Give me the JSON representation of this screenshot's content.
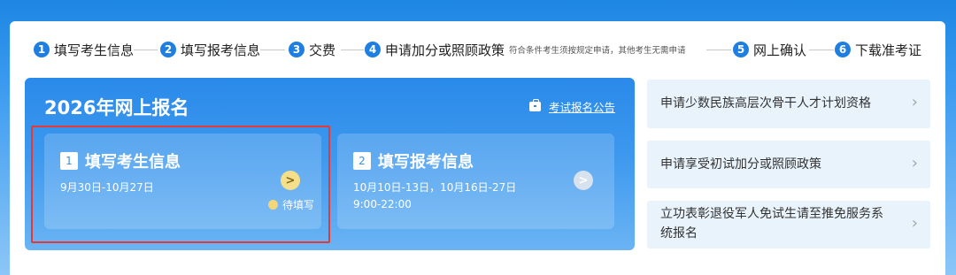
{
  "steps": [
    {
      "num": "1",
      "label": "填写考生信息"
    },
    {
      "num": "2",
      "label": "填写报考信息"
    },
    {
      "num": "3",
      "label": "交费"
    },
    {
      "num": "4",
      "label": "申请加分或照顾政策",
      "note": "符合条件考生须按规定申请，其他考生无需申请"
    },
    {
      "num": "5",
      "label": "网上确认"
    },
    {
      "num": "6",
      "label": "下载准考证"
    }
  ],
  "panel": {
    "title": "2026年网上报名",
    "notice": "考试报名公告",
    "cards": [
      {
        "num": "1",
        "title": "填写考生信息",
        "date": "9月30日-10月27日",
        "status": "待填写"
      },
      {
        "num": "2",
        "title": "填写报考信息",
        "date_line1": "10月10日-13日，10月16日-27日",
        "date_line2": "9:00-22:00"
      }
    ]
  },
  "links": [
    {
      "label": "申请少数民族高层次骨干人才计划资格"
    },
    {
      "label": "申请享受初试加分或照顾政策"
    },
    {
      "label_line1": "立功表彰退役军人免试生请至推免服务系",
      "label_line2": "统报名"
    }
  ],
  "icons": {
    "chevron": "›",
    "arrow": ">"
  }
}
